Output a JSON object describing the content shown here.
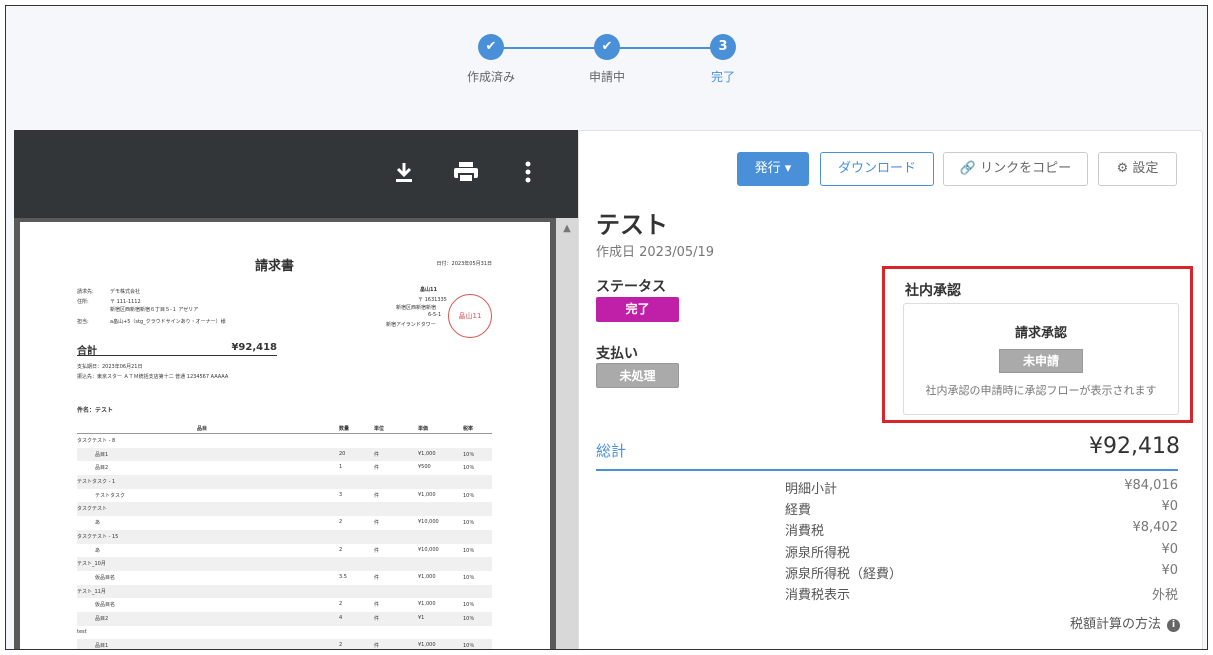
{
  "stepper": {
    "steps": [
      {
        "label": "作成済み",
        "mark": "✔"
      },
      {
        "label": "申請中",
        "mark": "✔"
      },
      {
        "label": "完了",
        "mark": "3"
      }
    ]
  },
  "viewer": {
    "icons": [
      "download-icon",
      "print-icon",
      "more-vert-icon"
    ],
    "doc": {
      "title": "請求書",
      "date": "日付：2023年05月31日",
      "to_label": "請求先:",
      "to_value": "デモ株式会社",
      "addr_label": "住所:",
      "addr_value": "〒 111-1112",
      "addr_line2": "新宿区西新宿新宿６丁目５-１ アゼリア",
      "attn_label": "担当:",
      "attn_value": "a畠山+5（stg_クラウドサインあり・オーナー）様",
      "issuer_name": "畠山11",
      "issuer_zip": "〒 1631335",
      "issuer_addr1": "新宿区西新宿新宿",
      "issuer_addr2": "6-5-1",
      "issuer_addr3": "新宿アイランドタワー",
      "stamp_text": "畠山11",
      "total_label": "合計",
      "total_value": "¥92,418",
      "due": "支払期日：2023年06月21日",
      "bank": "振込先：東京スター ＡＴＭ統括支店第十二 普通 1234567 AAAAA",
      "subject": "件名：テスト",
      "headers": [
        "品目",
        "数量",
        "単位",
        "単価",
        "税率"
      ],
      "rows": [
        {
          "type": "group",
          "name": "タスクテスト - 8"
        },
        {
          "type": "item",
          "name": "品目1",
          "qty": "20",
          "unit": "件",
          "price": "¥1,000",
          "tax": "10％"
        },
        {
          "type": "item",
          "name": "品目2",
          "qty": "1",
          "unit": "件",
          "price": "¥500",
          "tax": "10％"
        },
        {
          "type": "group",
          "name": "テストタスク - 1"
        },
        {
          "type": "item",
          "name": "テストタスク",
          "qty": "3",
          "unit": "件",
          "price": "¥1,000",
          "tax": "10％"
        },
        {
          "type": "group",
          "name": "タスクテスト"
        },
        {
          "type": "item",
          "name": "あ",
          "qty": "2",
          "unit": "件",
          "price": "¥10,000",
          "tax": "10％"
        },
        {
          "type": "group",
          "name": "タスクテスト - 15"
        },
        {
          "type": "item",
          "name": "あ",
          "qty": "2",
          "unit": "件",
          "price": "¥10,000",
          "tax": "10％"
        },
        {
          "type": "group",
          "name": "テスト_10月"
        },
        {
          "type": "item",
          "name": "仮品目名",
          "qty": "3.5",
          "unit": "件",
          "price": "¥1,000",
          "tax": "10％"
        },
        {
          "type": "group",
          "name": "テスト_11月"
        },
        {
          "type": "item",
          "name": "仮品目名",
          "qty": "2",
          "unit": "件",
          "price": "¥1,000",
          "tax": "10％"
        },
        {
          "type": "item",
          "name": "品目2",
          "qty": "4",
          "unit": "件",
          "price": "¥1",
          "tax": "10％"
        },
        {
          "type": "group",
          "name": "test"
        },
        {
          "type": "item",
          "name": "品目1",
          "qty": "2",
          "unit": "件",
          "price": "¥1,000",
          "tax": "10％"
        }
      ]
    }
  },
  "toolbar": {
    "issue_label": "発行 ▾",
    "download_label": "ダウンロード",
    "copy_link_label": "🔗 リンクをコピー",
    "settings_label": "⚙ 設定"
  },
  "invoice": {
    "name": "テスト",
    "created": "作成日 2023/05/19",
    "status_label": "ステータス",
    "status_value": "完了",
    "payment_label": "支払い",
    "payment_value": "未処理"
  },
  "approval": {
    "title": "社内承認",
    "subtitle": "請求承認",
    "badge": "未申請",
    "note": "社内承認の申請時に承認フローが表示されます"
  },
  "summary": {
    "title": "総計",
    "total": "¥92,418",
    "rows": [
      {
        "label": "明細小計",
        "value": "¥84,016"
      },
      {
        "label": "経費",
        "value": "¥0"
      },
      {
        "label": "消費税",
        "value": "¥8,402"
      },
      {
        "label": "源泉所得税",
        "value": "¥0"
      },
      {
        "label": "源泉所得税（経費）",
        "value": "¥0"
      },
      {
        "label": "消費税表示",
        "value": "外税"
      }
    ],
    "tax_method": "税額計算の方法",
    "accent": "#4a90d9"
  }
}
